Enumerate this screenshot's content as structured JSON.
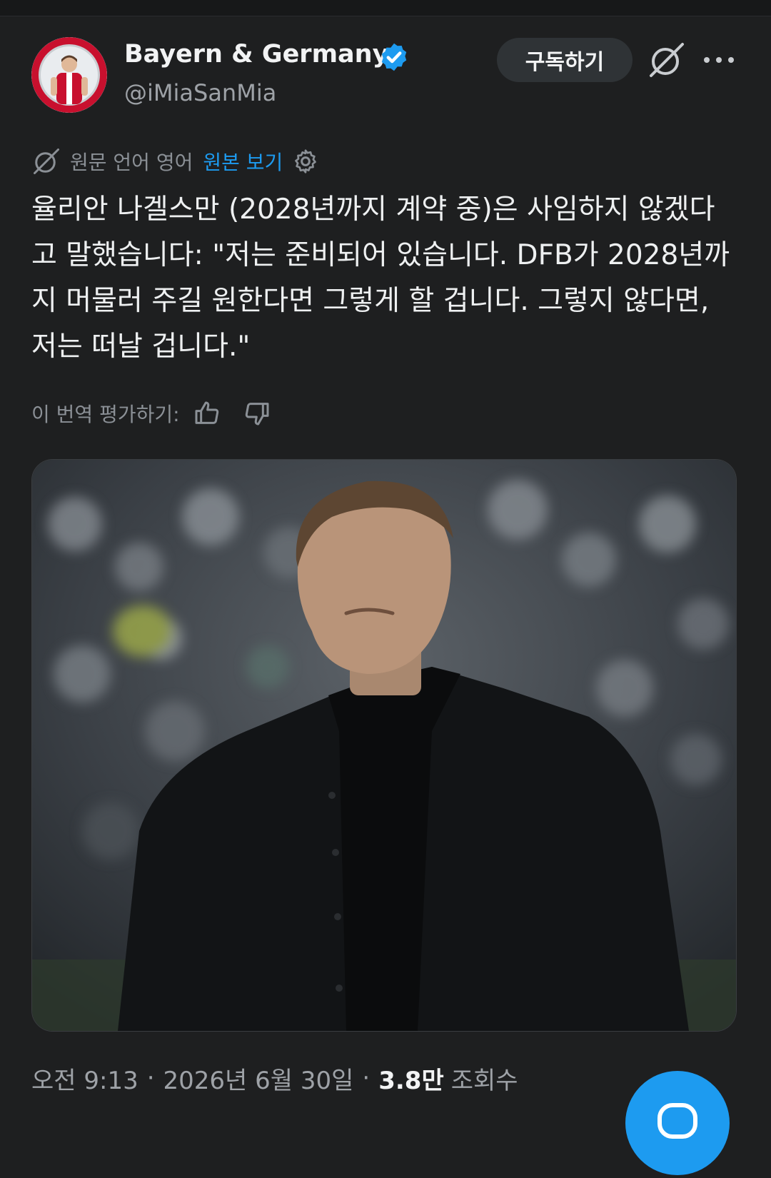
{
  "colors": {
    "background": "#1e1f20",
    "accent": "#1d9bf0",
    "muted": "#8b9096",
    "pill": "#2f3336"
  },
  "author": {
    "display_name": "Bayern & Germany",
    "handle": "@iMiaSanMia",
    "verified": true,
    "avatar_icon": "profile-photo"
  },
  "header_actions": {
    "subscribe_label": "구독하기",
    "grok_icon": "grok-icon",
    "more_icon": "more-dots-icon"
  },
  "translation": {
    "source_label": "원문 언어 영어",
    "show_original_label": "원본 보기",
    "settings_icon": "gear-icon",
    "rate_label": "이 번역 평가하기:",
    "thumbs_up_icon": "thumbs-up-icon",
    "thumbs_down_icon": "thumbs-down-icon"
  },
  "tweet": {
    "text": "율리안 나겔스만 (2028년까지 계약 중)은 사임하지 않겠다고 말했습니다: \"저는 준비되어 있습니다. DFB가 2028년까지 머물러 주길 원한다면 그렇게 할 겁니다. 그렇지 않다면, 저는 떠날 겁니다.\""
  },
  "meta": {
    "time": "오전 9:13",
    "date": "2026년 6월 30일",
    "views_count": "3.8만",
    "views_label": "조회수"
  }
}
